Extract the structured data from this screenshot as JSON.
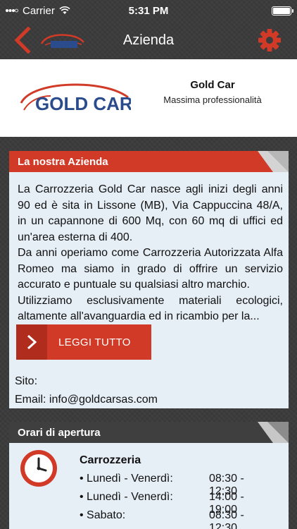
{
  "status": {
    "carrier": "Carrier",
    "time": "5:31 PM"
  },
  "nav": {
    "title": "Azienda",
    "back_icon": "chevron-left-icon",
    "settings_icon": "gear-icon",
    "logo_text": "GOLD CAR"
  },
  "company": {
    "logo_text": "GOLD CAR",
    "name": "Gold Car",
    "tagline": "Massima professionalità"
  },
  "about": {
    "title": "La nostra Azienda",
    "paragraphs": [
      "La Carrozzeria Gold Car nasce agli inizi degli anni 90 ed è sita in Lissone (MB), Via Cappuccina 48/A, in un capannone di 600 Mq, con 60 mq di uffici ed un'area esterna di 400.",
      "Da anni operiamo come Carrozzeria Autorizzata Alfa Romeo ma siamo in grado di offrire un servizio accurato e puntuale su qualsiasi altro marchio.",
      "Utilizziamo esclusivamente materiali ecologici, altamente all'avanguardia ed in ricambio per la..."
    ],
    "read_more": "LEGGI TUTTO",
    "site": "Sito:",
    "email": "Email: info@goldcarsas.com"
  },
  "hours": {
    "title": "Orari di apertura",
    "section": "Carrozzeria",
    "rows": [
      {
        "day": "• Lunedì - Venerdì:",
        "time": "08:30 - 12:30"
      },
      {
        "day": "• Lunedì - Venerdì:",
        "time": "14:00 - 19:00"
      },
      {
        "day": "• Sabato:",
        "time": "08:30 - 12:30"
      }
    ]
  },
  "colors": {
    "accent": "#d03a27",
    "dark_header": "#3f3f3f",
    "nav_background": "#3c3c3c"
  }
}
